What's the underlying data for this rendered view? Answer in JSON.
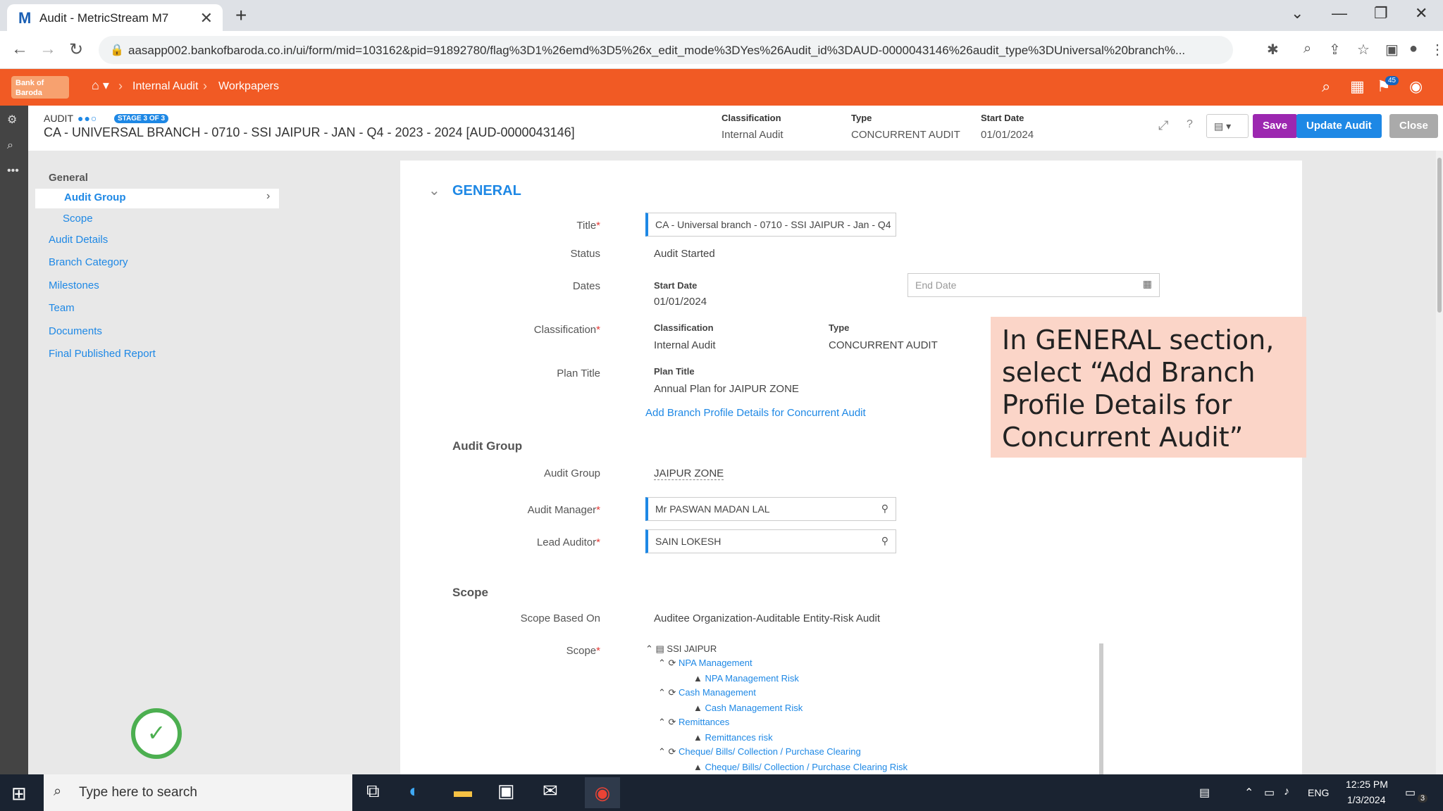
{
  "browser": {
    "tab_title": "Audit - MetricStream M7",
    "tab_icon": "M",
    "url": "aasapp002.bankofbaroda.co.in/ui/form/mid=103162&pid=91892780/flag%3D1%26emd%3D5%26x_edit_mode%3DYes%26Audit_id%3DAUD-0000043146%26audit_type%3DUniversal%20branch%...",
    "notif_count": "45"
  },
  "app": {
    "breadcrumbs": [
      "Internal Audit",
      "Workpapers"
    ]
  },
  "header": {
    "audit_label": "AUDIT",
    "stage": "STAGE 3 OF 3",
    "title": "CA - UNIVERSAL BRANCH - 0710 - SSI JAIPUR - JAN - Q4 - 2023 - 2024 [AUD-0000043146]",
    "classification_label": "Classification",
    "classification_value": "Internal Audit",
    "type_label": "Type",
    "type_value": "CONCURRENT AUDIT",
    "start_date_label": "Start Date",
    "start_date_value": "01/01/2024",
    "save_label": "Save",
    "update_label": "Update Audit",
    "close_label": "Close"
  },
  "sidebar": {
    "heading": "General",
    "items": [
      "Audit Group",
      "Scope",
      "Audit Details",
      "Branch Category",
      "Milestones",
      "Team",
      "Documents",
      "Final Published Report"
    ]
  },
  "general": {
    "heading": "GENERAL",
    "title_label": "Title",
    "title_value": "CA - Universal branch - 0710 - SSI JAIPUR - Jan - Q4",
    "status_label": "Status",
    "status_value": "Audit Started",
    "dates_label": "Dates",
    "start_date_label": "Start Date",
    "start_date_value": "01/01/2024",
    "end_date_placeholder": "End Date",
    "classification_label": "Classification",
    "class_sub_label": "Classification",
    "class_sub_value": "Internal Audit",
    "type_sub_label": "Type",
    "type_sub_value": "CONCURRENT AUDIT",
    "plan_title_label": "Plan Title",
    "plan_title_sub": "Plan Title",
    "plan_title_value": "Annual Plan for JAIPUR ZONE",
    "add_branch_link": "Add Branch Profile Details for Concurrent Audit"
  },
  "audit_group": {
    "heading": "Audit Group",
    "group_label": "Audit Group",
    "group_value": "JAIPUR ZONE",
    "manager_label": "Audit Manager",
    "manager_value": "Mr PASWAN MADAN LAL",
    "lead_label": "Lead Auditor",
    "lead_value": "SAIN LOKESH"
  },
  "scope": {
    "heading": "Scope",
    "based_on_label": "Scope Based On",
    "based_on_value": "Auditee Organization-Auditable Entity-Risk Audit",
    "scope_label": "Scope",
    "tree": [
      "SSI JAIPUR",
      "NPA Management",
      "NPA Management Risk",
      "Cash Management",
      "Cash Management Risk",
      "Remittances",
      "Remittances risk",
      "Cheque/ Bills/ Collection / Purchase Clearing",
      "Cheque/ Bills/ Collection / Purchase Clearing Risk"
    ]
  },
  "callout": {
    "text": "In GENERAL section, select “Add Branch Profile Details for Concurrent Audit”"
  },
  "taskbar": {
    "search_placeholder": "Type here to search",
    "lang": "ENG",
    "time": "12:25 PM",
    "date": "1/3/2024",
    "notif": "3"
  }
}
